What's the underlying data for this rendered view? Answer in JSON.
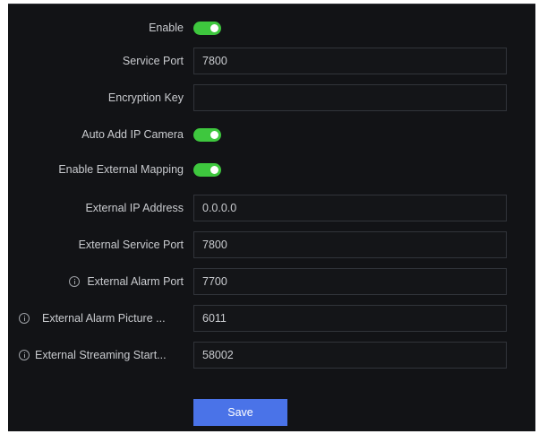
{
  "colors": {
    "panel_background": "#121316",
    "toggle_on": "#3ec73e",
    "save_button": "#4a73e8",
    "label_text": "#c9cbcf",
    "field_border": "#31343a"
  },
  "form": {
    "enable": {
      "label": "Enable",
      "on": true
    },
    "service_port": {
      "label": "Service Port",
      "value": "7800"
    },
    "encryption_key": {
      "label": "Encryption Key",
      "value": ""
    },
    "auto_add_ip_camera": {
      "label": "Auto Add IP Camera",
      "on": true
    },
    "enable_external_mapping": {
      "label": "Enable External Mapping",
      "on": true
    },
    "external_ip_address": {
      "label": "External IP Address",
      "value": "0.0.0.0"
    },
    "external_service_port": {
      "label": "External Service Port",
      "value": "7800"
    },
    "external_alarm_port": {
      "label": "External Alarm Port",
      "value": "7700",
      "icon": "info-icon"
    },
    "external_alarm_picture": {
      "label": "External Alarm Picture ...",
      "value": "6011",
      "icon": "info-icon"
    },
    "external_streaming_start": {
      "label": "External Streaming Start...",
      "value": "58002",
      "icon": "info-icon"
    }
  },
  "actions": {
    "save_label": "Save"
  }
}
